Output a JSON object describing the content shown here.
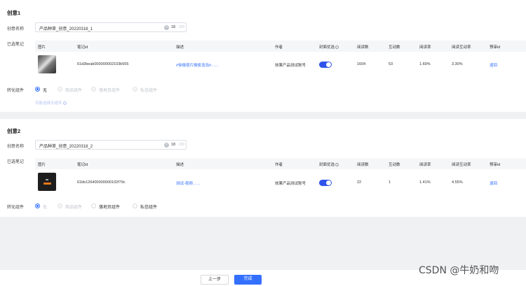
{
  "creatives": [
    {
      "title": "创意1",
      "name_label": "创意名称",
      "name_value": "产品种草_创意_20220318_1",
      "char_count": "18",
      "char_max": "/20",
      "notes_label": "已选笔记",
      "table": {
        "headers": [
          "图片",
          "笔记id",
          "描述",
          "作者",
          "封面优选",
          "阅读数",
          "互动数",
          "阅读率",
          "阅读互动率",
          "预审id"
        ],
        "row": {
          "note_id": "61d3beab000000002103b555",
          "description": "#徐俄夜片微俊浩浩#……",
          "author": "效果产品测试账号",
          "reads": "1604",
          "interactions": "53",
          "read_rate": "1.69%",
          "read_interact_rate": "3.30%",
          "action": "退回"
        }
      },
      "conversion_label": "转化组件",
      "conversion_options": [
        "无",
        "商品组件",
        "落地页组件",
        "私信组件"
      ],
      "hint": "仅能选择无组件"
    },
    {
      "title": "创意2",
      "name_label": "创意名称",
      "name_value": "产品种草_创意_20220318_2",
      "char_count": "18",
      "char_max": "/20",
      "notes_label": "已选笔记",
      "table": {
        "headers": [
          "图片",
          "笔记id",
          "描述",
          "作者",
          "封面优选",
          "阅读数",
          "互动数",
          "阅读率",
          "阅读互动率",
          "预审id"
        ],
        "row": {
          "note_id": "61bb126400000000102f79c",
          "description": "测试-视频……",
          "author": "效果产品测试账号",
          "reads": "22",
          "interactions": "1",
          "read_rate": "1.41%",
          "read_interact_rate": "4.55%",
          "action": "退回"
        }
      },
      "conversion_label": "转化组件",
      "conversion_options": [
        "无",
        "商品组件",
        "落地页组件",
        "私信组件"
      ]
    }
  ],
  "footer": {
    "prev_label": "上一步",
    "done_label": "完成"
  },
  "watermark": "CSDN @牛奶和吻",
  "colors": {
    "accent": "#3370ff",
    "toggle": "#2f54eb"
  }
}
